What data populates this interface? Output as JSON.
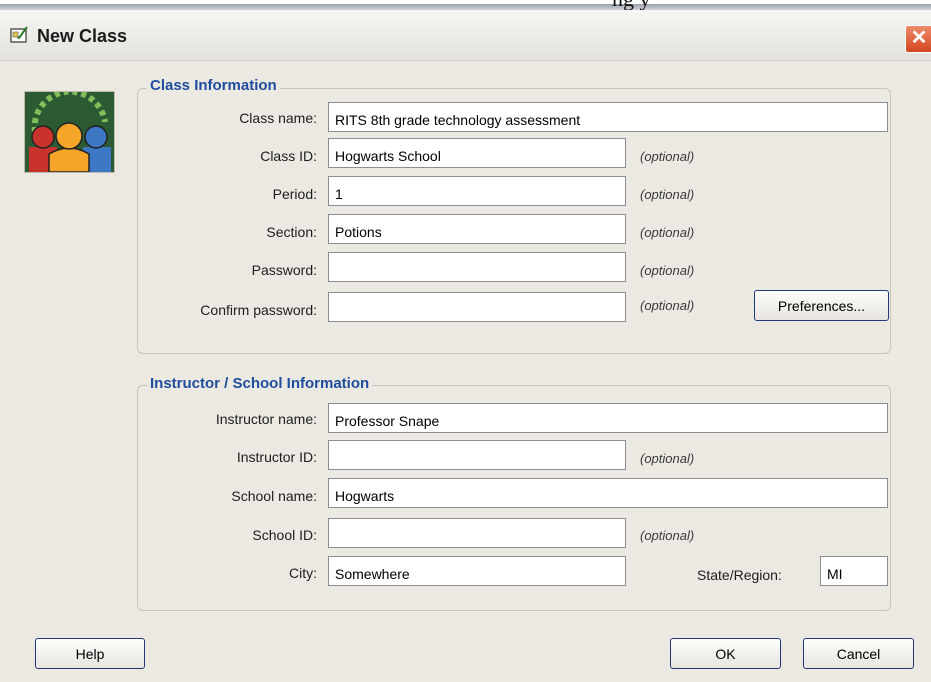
{
  "window": {
    "title": "New Class",
    "background_text": "ng y"
  },
  "class_info": {
    "group_title": "Class Information",
    "fields": {
      "class_name": {
        "label": "Class name:",
        "value": "RITS 8th grade technology assessment"
      },
      "class_id": {
        "label": "Class ID:",
        "value": "Hogwarts School"
      },
      "period": {
        "label": "Period:",
        "value": "1"
      },
      "section": {
        "label": "Section:",
        "value": "Potions"
      },
      "password": {
        "label": "Password:",
        "value": ""
      },
      "confirm_password": {
        "label": "Confirm password:",
        "value": ""
      }
    },
    "optional_text": "(optional)",
    "preferences_button": {
      "mnemonic": "P",
      "rest": "references..."
    }
  },
  "instructor_info": {
    "group_title": "Instructor / School Information",
    "fields": {
      "instructor_name": {
        "label": "Instructor name:",
        "value": "Professor Snape"
      },
      "instructor_id": {
        "label": "Instructor ID:",
        "value": ""
      },
      "school_name": {
        "label": "School name:",
        "value": "Hogwarts"
      },
      "school_id": {
        "label": "School ID:",
        "value": ""
      },
      "city": {
        "label": "City:",
        "value": "Somewhere"
      },
      "state": {
        "label": "State/Region:",
        "value": "MI"
      }
    }
  },
  "buttons": {
    "help": {
      "mnemonic": "H",
      "rest": "elp"
    },
    "ok": {
      "mnemonic": "O",
      "rest": "K"
    },
    "cancel": {
      "mnemonic": "C",
      "rest": "ancel"
    }
  },
  "colors": {
    "group_title": "#1e4d9e",
    "close_button": "#d2461f",
    "dialog_bg": "#ece9e2"
  },
  "icons": {
    "title": "new-class-icon",
    "logo": "people-group-icon",
    "close": "close-icon"
  }
}
